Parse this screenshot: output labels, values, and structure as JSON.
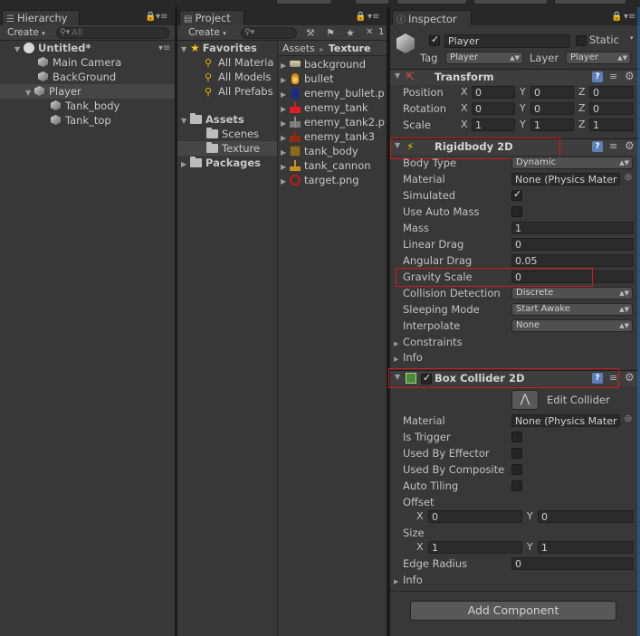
{
  "hierarchy": {
    "tab_label": "Hierarchy",
    "create_label": "Create",
    "search_placeholder": "All",
    "scene_name": "Untitled*",
    "items": [
      {
        "label": "Main Camera"
      },
      {
        "label": "BackGround"
      },
      {
        "label": "Player"
      },
      {
        "label": "Tank_body"
      },
      {
        "label": "Tank_top"
      }
    ]
  },
  "project": {
    "tab_label": "Project",
    "create_label": "Create",
    "favorites": {
      "label": "Favorites",
      "items": [
        "All Materia",
        "All Models",
        "All Prefabs"
      ]
    },
    "assets": {
      "label": "Assets",
      "items": [
        "Scenes",
        "Texture"
      ]
    },
    "packages_label": "Packages",
    "breadcrumb": {
      "root": "Assets",
      "sep": "▸",
      "current": "Texture"
    },
    "toolbar_count": "1",
    "files": [
      {
        "label": "background",
        "icon": "background-sprite-icon"
      },
      {
        "label": "bullet",
        "icon": "bullet-sprite-icon"
      },
      {
        "label": "enemy_bullet.p",
        "icon": "enemy-bullet-sprite-icon"
      },
      {
        "label": "enemy_tank",
        "icon": "enemy-tank-sprite-icon"
      },
      {
        "label": "enemy_tank2.p",
        "icon": "enemy-tank2-sprite-icon"
      },
      {
        "label": "enemy_tank3",
        "icon": "enemy-tank3-sprite-icon"
      },
      {
        "label": "tank_body",
        "icon": "tank-body-sprite-icon"
      },
      {
        "label": "tank_cannon",
        "icon": "tank-cannon-sprite-icon"
      },
      {
        "label": "target.png",
        "icon": "target-sprite-icon"
      }
    ]
  },
  "inspector": {
    "tab_label": "Inspector",
    "object_name": "Player",
    "static_label": "Static",
    "tag_label": "Tag",
    "tag_value": "Player",
    "layer_label": "Layer",
    "layer_value": "Player",
    "transform": {
      "title": "Transform",
      "position_label": "Position",
      "rotation_label": "Rotation",
      "scale_label": "Scale",
      "x": "X",
      "y": "Y",
      "z": "Z",
      "position": [
        "0",
        "0",
        "0"
      ],
      "rotation": [
        "0",
        "0",
        "0"
      ],
      "scale": [
        "1",
        "1",
        "1"
      ]
    },
    "rigidbody": {
      "title": "Rigidbody 2D",
      "body_type_label": "Body Type",
      "body_type_value": "Dynamic",
      "material_label": "Material",
      "material_value": "None (Physics Mater",
      "simulated_label": "Simulated",
      "simulated": true,
      "use_auto_mass_label": "Use Auto Mass",
      "use_auto_mass": false,
      "mass_label": "Mass",
      "mass_value": "1",
      "linear_drag_label": "Linear Drag",
      "linear_drag_value": "0",
      "angular_drag_label": "Angular Drag",
      "angular_drag_value": "0.05",
      "gravity_scale_label": "Gravity Scale",
      "gravity_scale_value": "0",
      "collision_detection_label": "Collision Detection",
      "collision_detection_value": "Discrete",
      "sleeping_mode_label": "Sleeping Mode",
      "sleeping_mode_value": "Start Awake",
      "interpolate_label": "Interpolate",
      "interpolate_value": "None",
      "constraints_label": "Constraints",
      "info_label": "Info"
    },
    "box_collider": {
      "title": "Box Collider 2D",
      "edit_collider_label": "Edit Collider",
      "material_label": "Material",
      "material_value": "None (Physics Mater",
      "is_trigger_label": "Is Trigger",
      "used_by_effector_label": "Used By Effector",
      "used_by_composite_label": "Used By Composite",
      "auto_tiling_label": "Auto Tiling",
      "offset_label": "Offset",
      "offset": [
        "0",
        "0"
      ],
      "size_label": "Size",
      "size": [
        "1",
        "1"
      ],
      "x": "X",
      "y": "Y",
      "edge_radius_label": "Edge Radius",
      "edge_radius_value": "0",
      "info_label": "Info"
    },
    "add_component_label": "Add Component"
  },
  "colors": {
    "background": "#383838",
    "highlight_box": "#d81818",
    "selected_row": "#464646"
  }
}
